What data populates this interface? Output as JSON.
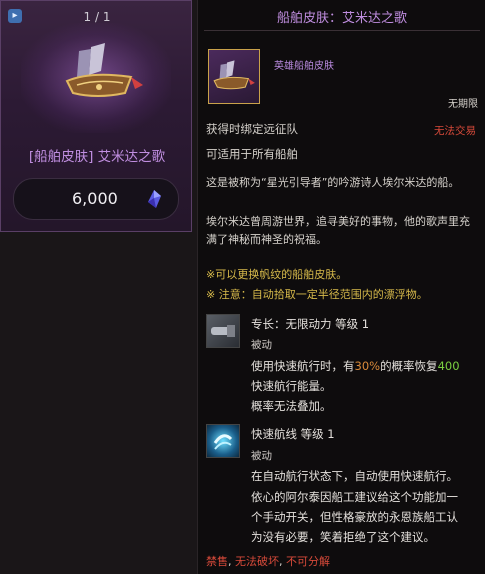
{
  "shop_card": {
    "page_indicator": "1 / 1",
    "tag_icon": "tag-icon",
    "title": "[船舶皮肤] 艾米达之歌",
    "price": "6,000",
    "currency_icon": "crystal-icon"
  },
  "tooltip": {
    "title": "船舶皮肤：艾米达之歌",
    "item_type": "英雄船舶皮肤",
    "limit": "无期限",
    "bind": "获得时绑定远征队",
    "trade": "无法交易",
    "usable": "可适用于所有船舶",
    "desc1": "这是被称为“星光引导者”的吟游诗人埃尔米达的船。",
    "desc2a": "埃尔米达曾周游世界，追寻美好的事物，他的歌声里充",
    "desc2b": "满了神秘而神圣的祝福。",
    "note1": "※可以更换帆纹的船舶皮肤。",
    "note2": "※ 注意：自动拾取一定半径范围内的漂浮物。",
    "skill1": {
      "name": "专长：无限动力 等级 1",
      "type": "被动",
      "l1_pre": "使用快速航行时，有",
      "l1_pct": "30%",
      "l1_mid": "的概率恢复",
      "l1_val": "400",
      "l2": "快速航行能量。",
      "l3": "概率无法叠加。"
    },
    "skill2": {
      "name": "快速航线 等级 1",
      "type": "被动",
      "l1": "在自动航行状态下，自动使用快速航行。",
      "l2": "依心的阿尔泰因船工建议给这个功能加一",
      "l3": "个手动开关，但性格豪放的永恩族船工认",
      "l4": "为没有必要，笑着拒绝了这个建议。"
    },
    "footer": {
      "a": "禁售",
      "sep1": ", ",
      "b": "无法破坏",
      "sep2": ", ",
      "c": "不可分解"
    }
  },
  "colors": {
    "rarity_purple": "#c08ee0",
    "warning_red": "#d84a3a",
    "note_yellow": "#d6b94a",
    "value_green": "#7ad040"
  }
}
